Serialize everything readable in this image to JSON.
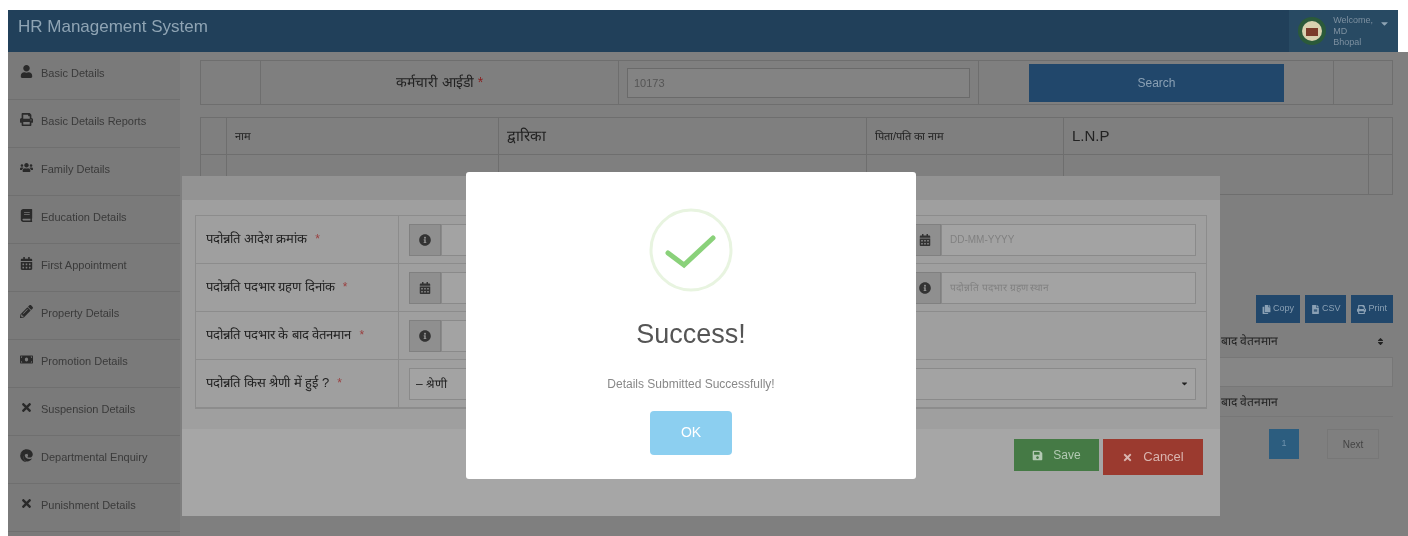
{
  "header": {
    "title": "HR Management System",
    "user_lines": [
      "Welcome,",
      "MD",
      "Bhopal"
    ]
  },
  "sidebar": {
    "items": [
      {
        "label": "Basic Details"
      },
      {
        "label": "Basic Details Reports"
      },
      {
        "label": "Family Details"
      },
      {
        "label": "Education Details"
      },
      {
        "label": "First Appointment"
      },
      {
        "label": "Property Details"
      },
      {
        "label": "Promotion Details"
      },
      {
        "label": "Suspension Details"
      },
      {
        "label": "Departmental Enquiry"
      },
      {
        "label": "Punishment Details"
      }
    ]
  },
  "search_form": {
    "label": "कर्मचारी आईडी",
    "mark": "*",
    "value": "10173",
    "button": "Search"
  },
  "employee_table": {
    "cells": [
      "नाम",
      "द्वारिका",
      "पिता/पति का नाम",
      "L.N.P"
    ]
  },
  "records_table": {
    "export_buttons": [
      "Copy",
      "CSV",
      "Print"
    ],
    "column": "बाद वेतनमान",
    "cell": "बाद वेतनमान",
    "pages": [
      {
        "label": "1",
        "selected": true
      }
    ],
    "next": "Next"
  },
  "promotion_form": {
    "rows": [
      {
        "label": "पदोन्नति आदेश क्रमांक",
        "mark": "*",
        "left": {
          "kind": "info"
        },
        "right": {
          "kind": "date",
          "placeholder": "DD-MM-YYYY"
        }
      },
      {
        "label": "पदोन्नति पदभार ग्रहण दिनांक",
        "mark": "*",
        "left": {
          "kind": "date"
        },
        "right": {
          "kind": "info",
          "placeholder": "पदोन्नति पदभार ग्रहण स्थान"
        }
      },
      {
        "label": "पदोन्नति पदभार के बाद वेतनमान",
        "mark": "*",
        "left": {
          "kind": "info"
        }
      },
      {
        "label": "पदोन्नति किस श्रेणी में हुई ?",
        "mark": "*",
        "select": {
          "value": "– श्रेणी"
        }
      }
    ],
    "buttons": [
      {
        "label": "Save",
        "kind": "save"
      },
      {
        "label": "Cancel",
        "kind": "cancel"
      }
    ]
  },
  "alert": {
    "title": "Success!",
    "message": "Details Submitted Successfully!",
    "button": "OK"
  }
}
